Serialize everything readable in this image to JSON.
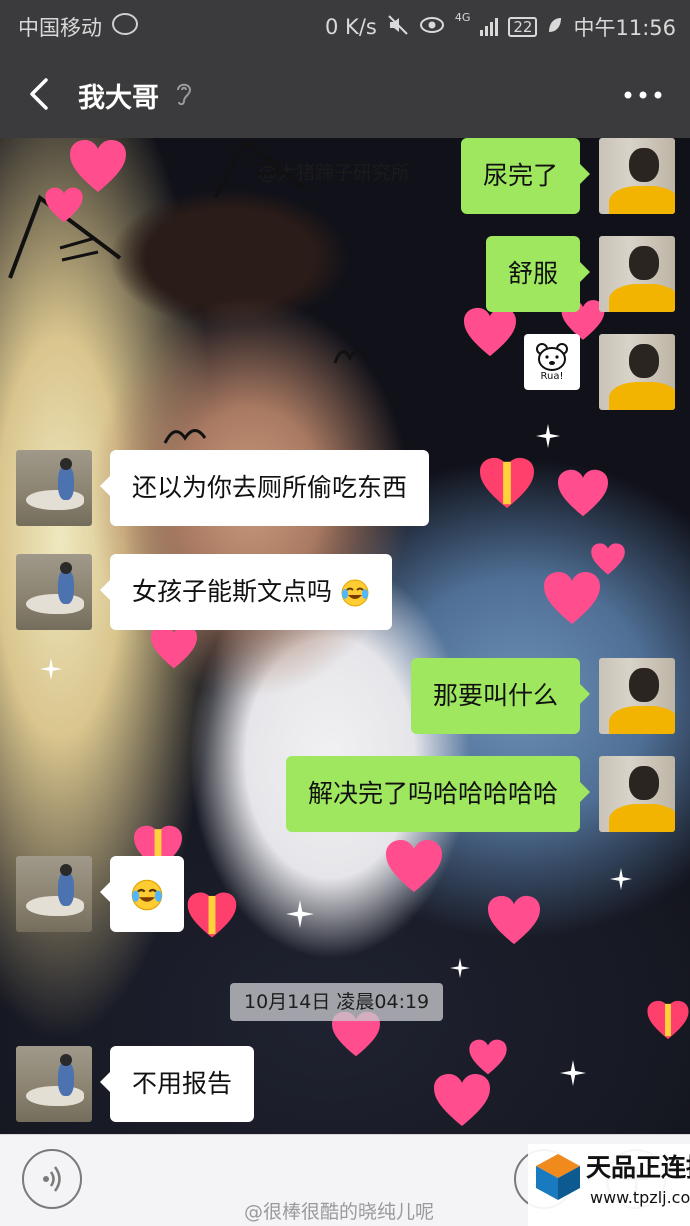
{
  "status_bar": {
    "carrier": "中国移动",
    "speed": "0 K/s",
    "network": "4G",
    "battery": "22",
    "time": "中午11:56"
  },
  "header": {
    "title": "我大哥",
    "icons": [
      "back-arrow-icon",
      "ear-icon",
      "more-icon"
    ]
  },
  "chat": {
    "background_watermark": "@大猪蹄子研究所",
    "messages": [
      {
        "side": "right",
        "text": "尿完了"
      },
      {
        "side": "right",
        "text": "舒服"
      },
      {
        "side": "right",
        "sticker_text": "Rua!"
      },
      {
        "side": "left",
        "text": "还以为你去厕所偷吃东西"
      },
      {
        "side": "left",
        "text": "女孩子能斯文点吗",
        "emoji": "crying-laughing"
      },
      {
        "side": "right",
        "text": "那要叫什么"
      },
      {
        "side": "right",
        "text": "解决完了吗哈哈哈哈哈"
      },
      {
        "side": "left",
        "emoji": "crying-laughing"
      },
      {
        "side": "left",
        "text": "不用报告"
      }
    ],
    "timestamp": "10月14日 凌晨04:19"
  },
  "input_bar": {
    "icons": [
      "voice-icon",
      "emoji-icon",
      "plus-icon"
    ],
    "weibo_watermark": "@很棒很酷的晓纯儿呢"
  },
  "brand_watermark": {
    "name": "天品正连接",
    "url": "www.tpzlj.com"
  },
  "colors": {
    "bar_bg": "#3b3b3d",
    "green_bubble": "#9fe75f",
    "white_bubble": "#ffffff",
    "heart_pink": "#ff4d8d"
  }
}
